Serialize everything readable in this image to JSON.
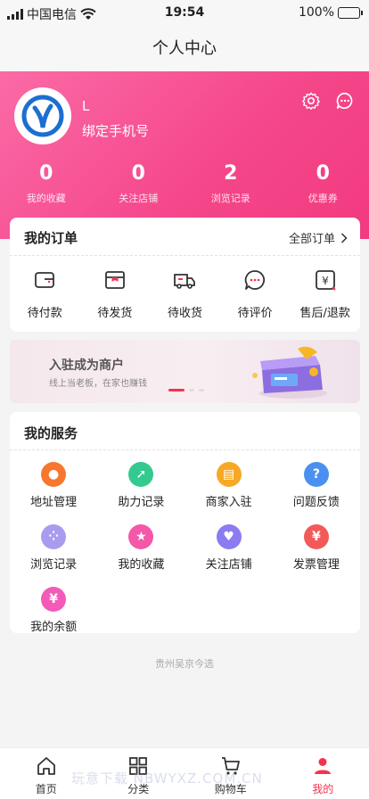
{
  "status_bar": {
    "carrier": "中国电信",
    "time": "19:54",
    "battery": "100%"
  },
  "title": "个人中心",
  "user": {
    "name": "L",
    "bind_phone": "绑定手机号"
  },
  "header_icons": [
    "gear-icon",
    "chat-icon"
  ],
  "stats": [
    {
      "value": "0",
      "label": "我的收藏"
    },
    {
      "value": "0",
      "label": "关注店铺"
    },
    {
      "value": "2",
      "label": "浏览记录"
    },
    {
      "value": "0",
      "label": "优惠券"
    }
  ],
  "orders": {
    "title": "我的订单",
    "all_label": "全部订单",
    "items": [
      {
        "label": "待付款",
        "icon": "wallet-icon"
      },
      {
        "label": "待发货",
        "icon": "box-icon"
      },
      {
        "label": "待收货",
        "icon": "truck-icon"
      },
      {
        "label": "待评价",
        "icon": "comment-icon"
      },
      {
        "label": "售后/退款",
        "icon": "refund-icon"
      }
    ]
  },
  "banner": {
    "title": "入驻成为商户",
    "subtitle": "线上当老板，在家也赚钱"
  },
  "services": {
    "title": "我的服务",
    "items": [
      {
        "label": "地址管理",
        "icon": "location-icon",
        "color": "#f7772f"
      },
      {
        "label": "助力记录",
        "icon": "rocket-icon",
        "color": "#34c98e"
      },
      {
        "label": "商家入驻",
        "icon": "store-icon",
        "color": "#f7a825"
      },
      {
        "label": "问题反馈",
        "icon": "question-icon",
        "color": "#4a90f0"
      },
      {
        "label": "浏览记录",
        "icon": "footprint-icon",
        "color": "#a99cf0"
      },
      {
        "label": "我的收藏",
        "icon": "star-icon",
        "color": "#f458a8"
      },
      {
        "label": "关注店铺",
        "icon": "heart-icon",
        "color": "#8b7cf0"
      },
      {
        "label": "发票管理",
        "icon": "invoice-icon",
        "color": "#f25a5a"
      },
      {
        "label": "我的余额",
        "icon": "money-bag-icon",
        "color": "#f45ab8"
      }
    ]
  },
  "footer": "贵州吴京今选",
  "tabs": [
    {
      "label": "首页",
      "icon": "home-icon"
    },
    {
      "label": "分类",
      "icon": "grid-icon"
    },
    {
      "label": "购物车",
      "icon": "cart-icon"
    },
    {
      "label": "我的",
      "icon": "user-icon"
    }
  ],
  "watermark": "玩意下载 NBWYXZ.COM.CN",
  "colors": {
    "brand_pink": "#f5468a",
    "active_red": "#f4334e"
  }
}
